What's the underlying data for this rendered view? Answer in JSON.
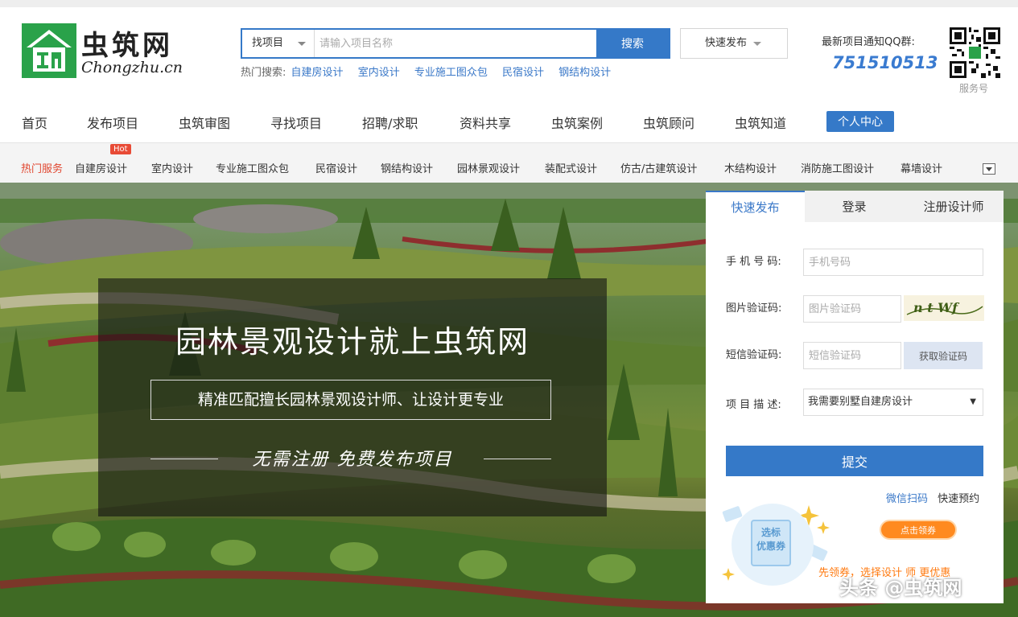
{
  "logo": {
    "cn": "虫筑网",
    "en": "Chongzhu.cn",
    "icon": "house-logo-icon"
  },
  "search": {
    "type_label": "找项目",
    "placeholder": "请输入项目名称",
    "button": "搜索",
    "hot_label": "热门搜索:",
    "hot_links": [
      "自建房设计",
      "室内设计",
      "专业施工图众包",
      "民宿设计",
      "钢结构设计"
    ]
  },
  "quick_publish": "快速发布",
  "qq": {
    "label": "最新项目通知QQ群:",
    "number": "751510513"
  },
  "qr_caption": "服务号",
  "main_nav": {
    "items": [
      "首页",
      "发布项目",
      "虫筑审图",
      "寻找项目",
      "招聘/求职",
      "资料共享",
      "虫筑案例",
      "虫筑顾问",
      "虫筑知道"
    ],
    "personal": "个人中心"
  },
  "service_bar": {
    "title": "热门服务",
    "hot_badge": "Hot",
    "items": [
      "自建房设计",
      "室内设计",
      "专业施工图众包",
      "民宿设计",
      "钢结构设计",
      "园林景观设计",
      "装配式设计",
      "仿古/古建筑设计",
      "木结构设计",
      "消防施工图设计",
      "幕墙设计"
    ]
  },
  "hero": {
    "title": "园林景观设计就上虫筑网",
    "subtitle": "精准匹配擅长园林景观设计师、让设计更专业",
    "tagline": "无需注册  免费发布项目"
  },
  "panel": {
    "tabs": [
      "快速发布",
      "登录",
      "注册设计师"
    ],
    "phone_label": "手 机 号 码:",
    "phone_placeholder": "手机号码",
    "captcha_label": "图片验证码:",
    "captcha_placeholder": "图片验证码",
    "captcha_text": "n t Wf",
    "sms_label": "短信验证码:",
    "sms_placeholder": "短信验证码",
    "sms_button": "获取验证码",
    "desc_label": "项 目 描 述:",
    "desc_value": "我需要别墅自建房设计",
    "submit": "提交",
    "link_wechat": "微信扫码",
    "link_reserve": "快速预约",
    "coupon_card_line1": "选标",
    "coupon_card_line2": "优惠券",
    "claim_button": "点击领券",
    "coupon_slogan": "先领券，选择设计 师 更优惠"
  },
  "watermark": "头条 @虫筑网",
  "colors": {
    "brand_green": "#2aa24a",
    "accent_blue": "#3579c8",
    "hot_red": "#e0462f",
    "coupon_orange": "#ff8a1f"
  }
}
